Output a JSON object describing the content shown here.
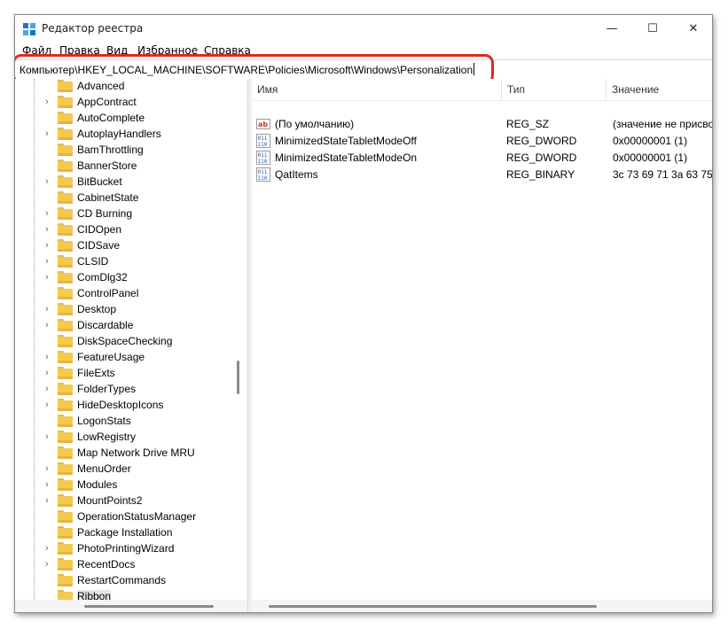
{
  "window": {
    "title": "Редактор реестра",
    "controls": {
      "minimize": "—",
      "maximize": "☐",
      "close": "✕"
    }
  },
  "menu": [
    {
      "hotkey": "Ф",
      "rest": "айл"
    },
    {
      "hotkey": "П",
      "rest": "равка"
    },
    {
      "hotkey": "В",
      "rest": "ид"
    },
    {
      "hotkey": "И",
      "rest": "збранное"
    },
    {
      "hotkey": "С",
      "rest": "правка"
    }
  ],
  "address": {
    "path": "Компьютер\\HKEY_LOCAL_MACHINE\\SOFTWARE\\Policies\\Microsoft\\Windows\\Personalization",
    "highlight_color": "#e02a1e"
  },
  "tree": {
    "items": [
      {
        "label": "Advanced",
        "expandable": false
      },
      {
        "label": "AppContract",
        "expandable": true
      },
      {
        "label": "AutoComplete",
        "expandable": false
      },
      {
        "label": "AutoplayHandlers",
        "expandable": true
      },
      {
        "label": "BamThrottling",
        "expandable": false
      },
      {
        "label": "BannerStore",
        "expandable": false
      },
      {
        "label": "BitBucket",
        "expandable": true
      },
      {
        "label": "CabinetState",
        "expandable": false
      },
      {
        "label": "CD Burning",
        "expandable": true
      },
      {
        "label": "CIDOpen",
        "expandable": true
      },
      {
        "label": "CIDSave",
        "expandable": true
      },
      {
        "label": "CLSID",
        "expandable": true
      },
      {
        "label": "ComDlg32",
        "expandable": true
      },
      {
        "label": "ControlPanel",
        "expandable": false
      },
      {
        "label": "Desktop",
        "expandable": true
      },
      {
        "label": "Discardable",
        "expandable": true
      },
      {
        "label": "DiskSpaceChecking",
        "expandable": false
      },
      {
        "label": "FeatureUsage",
        "expandable": true
      },
      {
        "label": "FileExts",
        "expandable": true
      },
      {
        "label": "FolderTypes",
        "expandable": true
      },
      {
        "label": "HideDesktopIcons",
        "expandable": true
      },
      {
        "label": "LogonStats",
        "expandable": false
      },
      {
        "label": "LowRegistry",
        "expandable": true
      },
      {
        "label": "Map Network Drive MRU",
        "expandable": false
      },
      {
        "label": "MenuOrder",
        "expandable": true
      },
      {
        "label": "Modules",
        "expandable": true
      },
      {
        "label": "MountPoints2",
        "expandable": true
      },
      {
        "label": "OperationStatusManager",
        "expandable": false
      },
      {
        "label": "Package Installation",
        "expandable": false
      },
      {
        "label": "PhotoPrintingWizard",
        "expandable": true
      },
      {
        "label": "RecentDocs",
        "expandable": true
      },
      {
        "label": "RestartCommands",
        "expandable": false
      },
      {
        "label": "Ribbon",
        "expandable": false,
        "selected": true
      }
    ]
  },
  "values": {
    "columns": {
      "name": "Имя",
      "type": "Тип",
      "data": "Значение"
    },
    "rows": [
      {
        "icon": "string-value-icon",
        "name": "(По умолчанию)",
        "type": "REG_SZ",
        "data": "(значение не присво"
      },
      {
        "icon": "binary-value-icon",
        "name": "MinimizedStateTabletModeOff",
        "type": "REG_DWORD",
        "data": "0x00000001 (1)"
      },
      {
        "icon": "binary-value-icon",
        "name": "MinimizedStateTabletModeOn",
        "type": "REG_DWORD",
        "data": "0x00000001 (1)"
      },
      {
        "icon": "binary-value-icon",
        "name": "QatItems",
        "type": "REG_BINARY",
        "data": "3c 73 69 71 3a 63 75 7"
      }
    ]
  },
  "colors": {
    "folder": "#f3c94f",
    "accent_blue": "#1f6fd1",
    "highlight": "#e02a1e"
  }
}
